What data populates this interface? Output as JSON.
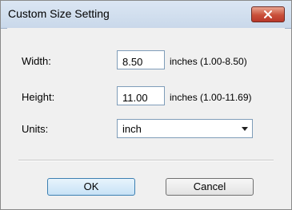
{
  "window": {
    "title": "Custom Size Setting"
  },
  "fields": {
    "width": {
      "label": "Width:",
      "value": "8.50",
      "range": "inches (1.00-8.50)"
    },
    "height": {
      "label": "Height:",
      "value": "11.00",
      "range": "inches (1.00-11.69)"
    }
  },
  "units": {
    "label": "Units:",
    "selected": "inch"
  },
  "buttons": {
    "ok": "OK",
    "cancel": "Cancel"
  },
  "colors": {
    "close_button": "#c9503a",
    "titlebar": "#dbe6f3"
  }
}
